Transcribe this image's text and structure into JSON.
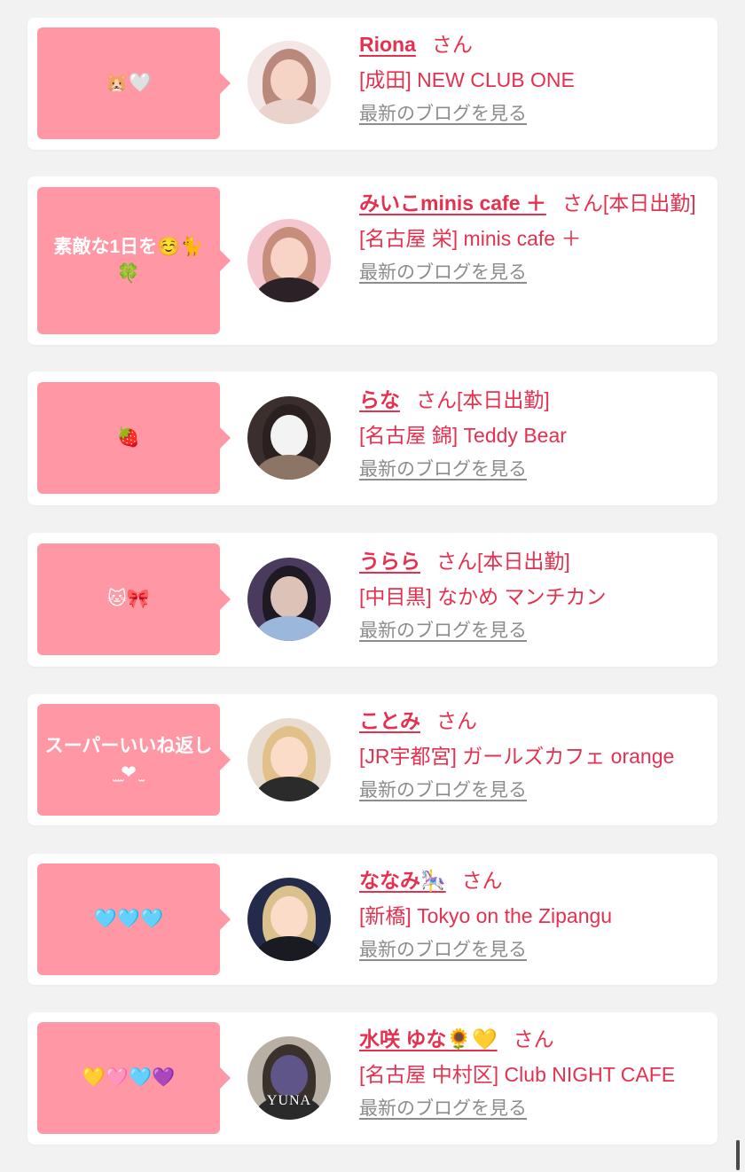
{
  "blog_link_label": "最新のブログを見る",
  "san_label": "さん",
  "colors": {
    "bubble": "#ff97a4",
    "accent": "#e5314f",
    "link_gray": "#8c8c8c",
    "page_bg": "#f2f2f2"
  },
  "entries": [
    {
      "comment": "🐹🤍",
      "name": "Riona",
      "status": "",
      "shop": "[成田] NEW CLUB ONE"
    },
    {
      "comment": "素敵な1日を☺️🐈🍀",
      "name": "みいこminis cafe ＋",
      "status": "[本日出勤]",
      "shop": "[名古屋 栄] minis cafe ＋"
    },
    {
      "comment": "🍓",
      "name": "らな",
      "status": "[本日出勤]",
      "shop": "[名古屋 錦] Teddy Bear"
    },
    {
      "comment": "🐱🎀",
      "name": "うらら",
      "status": "[本日出勤]",
      "shop": "[中目黒] なかめ マンチカン"
    },
    {
      "comment": "スーパーいいね返し ̫ ̫❤︎ ̫",
      "name": "ことみ",
      "status": "",
      "shop": "[JR宇都宮] ガールズカフェ orange"
    },
    {
      "comment": "🩵🩵🩵",
      "name": "ななみ🎠",
      "status": "",
      "shop": "[新橋] Tokyo on the Zipangu"
    },
    {
      "comment": "💛🩷🩵💜",
      "name": "水咲 ゆな🌻💛",
      "status": "",
      "shop": "[名古屋 中村区] Club NIGHT CAFE",
      "avatar_caption": "YUNA"
    }
  ]
}
